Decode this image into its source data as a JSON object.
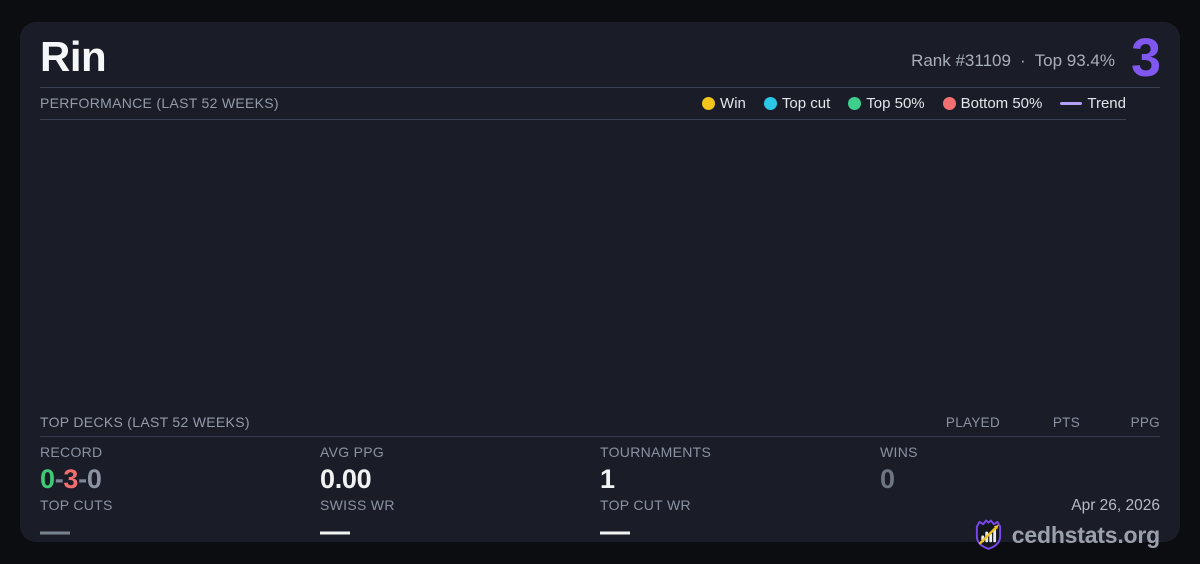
{
  "colors": {
    "page_bg": "#0c0d11",
    "card_bg": "#1a1d27",
    "divider": "#3a4153",
    "accent_purple": "#8158ef",
    "record_win_green": "#3ecb76",
    "record_loss_red": "#f26d6d",
    "record_draw_gray": "#8b93a3",
    "record_sep_gray": "#7e8698",
    "dim_gray": "#6e7684",
    "dash_gray": "#79828f",
    "value_white": "#f1f2f4"
  },
  "header": {
    "title": "Rin",
    "rank": "Rank #31109",
    "separator": "·",
    "top_percent": "Top 93.4%",
    "points_badge": "3"
  },
  "performance": {
    "section_title": "PERFORMANCE (LAST 52 WEEKS)",
    "legend": [
      {
        "label": "Win",
        "color": "#f2c51d",
        "shape": "dot"
      },
      {
        "label": "Top cut",
        "color": "#2cc8e8",
        "shape": "dot"
      },
      {
        "label": "Top 50%",
        "color": "#3ecf8e",
        "shape": "dot"
      },
      {
        "label": "Bottom 50%",
        "color": "#f47070",
        "shape": "dot"
      },
      {
        "label": "Trend",
        "color": "#b3a1f7",
        "shape": "line"
      }
    ]
  },
  "chart_data": {
    "type": "scatter",
    "title": "PERFORMANCE (LAST 52 WEEKS)",
    "x_range": "last 52 weeks",
    "legend_position": "top-right",
    "grid": false,
    "series": [
      {
        "name": "Win",
        "points": []
      },
      {
        "name": "Top cut",
        "points": []
      },
      {
        "name": "Top 50%",
        "points": []
      },
      {
        "name": "Bottom 50%",
        "points": []
      },
      {
        "name": "Trend",
        "points": []
      }
    ],
    "note": "chart plot area is empty - no data points rendered"
  },
  "top_decks": {
    "section_title": "TOP DECKS (LAST 52 WEEKS)",
    "columns": [
      "PLAYED",
      "PTS",
      "PPG"
    ],
    "rows": []
  },
  "stats": {
    "record_label": "RECORD",
    "record_wins": "0",
    "record_losses": "3",
    "record_draws": "0",
    "record_separator": "-",
    "avg_ppg_label": "AVG PPG",
    "avg_ppg_value": "0.00",
    "tournaments_label": "TOURNAMENTS",
    "tournaments_value": "1",
    "wins_label": "WINS",
    "wins_value": "0",
    "top_cuts_label": "TOP CUTS",
    "top_cuts_value": "—",
    "swiss_wr_label": "SWISS WR",
    "swiss_wr_value": "—",
    "top_cut_wr_label": "TOP CUT WR",
    "top_cut_wr_value": "—"
  },
  "footer": {
    "date": "Apr 26, 2026",
    "brand": "cedhstats.org"
  }
}
